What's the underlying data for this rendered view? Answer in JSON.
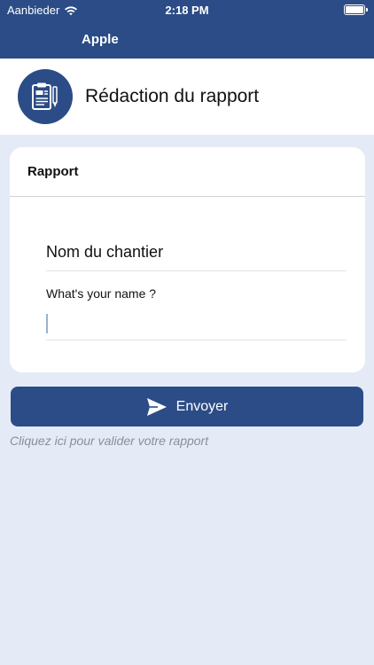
{
  "status_bar": {
    "carrier": "Aanbieder",
    "time": "2:18 PM"
  },
  "nav": {
    "title": "Apple"
  },
  "header": {
    "title": "Rédaction du rapport",
    "icon": "clipboard-report-icon"
  },
  "card": {
    "title": "Rapport",
    "site_field_label": "Nom du chantier",
    "name_label": "What's your name ?",
    "name_value": ""
  },
  "send_button": {
    "label": "Envoyer",
    "icon": "send-icon"
  },
  "hint": "Cliquez ici pour valider votre rapport",
  "colors": {
    "primary": "#2b4c86",
    "background": "#e4ebf7",
    "card": "#ffffff",
    "hint": "#8a8f98"
  }
}
